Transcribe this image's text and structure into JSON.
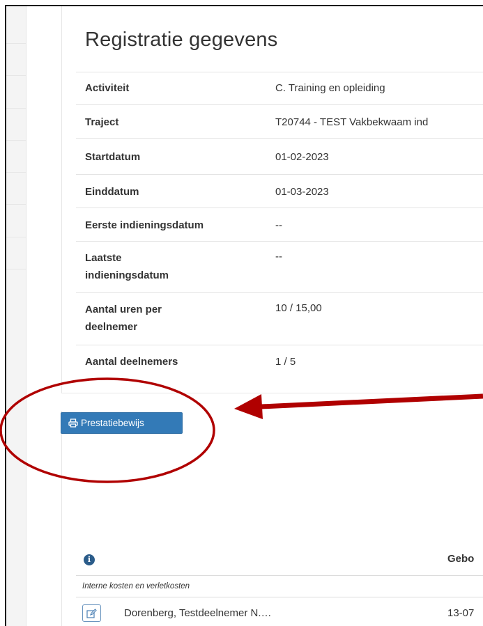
{
  "registration": {
    "title": "Registratie gegevens",
    "rows": [
      {
        "label": "Activiteit",
        "value": "C. Training en opleiding"
      },
      {
        "label": "Traject",
        "value": "T20744 - TEST Vakbekwaam ind"
      },
      {
        "label": "Startdatum",
        "value": "01-02-2023"
      },
      {
        "label": "Einddatum",
        "value": "01-03-2023"
      },
      {
        "label": "Eerste indieningsdatum",
        "value": "--"
      },
      {
        "label": "Laatste indieningsdatum",
        "value": "--"
      },
      {
        "label": "Aantal uren per deelnemer",
        "value": "10 / 15,00"
      },
      {
        "label": "Aantal deelnemers",
        "value": "1 / 5"
      }
    ]
  },
  "actions": {
    "prestatiebewijs_label": "Prestatiebewijs"
  },
  "participants": {
    "info_icon_glyph": "i",
    "column_birth": "Gebo",
    "group_label": "Interne kosten en verletkosten",
    "rows": [
      {
        "name": "Dorenberg, Testdeelnemer N.…",
        "birth_date": "13-07"
      }
    ]
  },
  "colors": {
    "primary_button": "#337ab7",
    "annotation_red": "#b00000"
  },
  "icons": {
    "button": "print-icon",
    "row_edit": "edit-icon",
    "info": "info-icon"
  }
}
